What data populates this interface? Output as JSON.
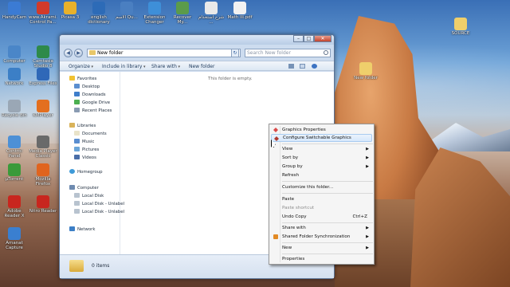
{
  "desktop": {
    "icons": [
      {
        "label": "HandyCam",
        "color": "#3b7bd4"
      },
      {
        "label": "www.Akrami... Control Pa...",
        "color": "#d23a2a"
      },
      {
        "label": "Picasa 3",
        "color": "#e8b12a"
      },
      {
        "label": "english dictionary",
        "color": "#2d6bb7"
      },
      {
        "label": "الاسم Qu...",
        "color": "#4a7fc1"
      },
      {
        "label": "Extension Changer",
        "color": "#3e8fd8"
      },
      {
        "label": "Recover My...",
        "color": "#5b9b4a"
      },
      {
        "label": "شرح استخدام ...",
        "color": "#e9e9e9"
      },
      {
        "label": "Math III.pdf",
        "color": "#f2f2f2"
      },
      {
        "label": "Computer",
        "color": "#4a86c8"
      },
      {
        "label": "Camtasia Studio 8",
        "color": "#2e8a4a"
      },
      {
        "label": "Network",
        "color": "#3c7fc6"
      },
      {
        "label": "Express Files",
        "color": "#2f68b8"
      },
      {
        "label": "Recycle Bin",
        "color": "#9aa7b5"
      },
      {
        "label": "KMPlayer",
        "color": "#e36f1f"
      },
      {
        "label": "Control Panel",
        "color": "#4d90d6"
      },
      {
        "label": "Media Player Classic",
        "color": "#6a6a6a"
      },
      {
        "label": "µTorrent",
        "color": "#3a9a3a"
      },
      {
        "label": "Mozilla Firefox",
        "color": "#e0641e"
      },
      {
        "label": "Adobe Reader X",
        "color": "#c8261e"
      },
      {
        "label": "Nitro Reader",
        "color": "#c8261e"
      },
      {
        "label": "Amanat Capture",
        "color": "#3a7fd0"
      },
      {
        "label": "SOURCE",
        "color": "#efcf6b"
      },
      {
        "label": "New folder",
        "color": "#efcf6b"
      }
    ]
  },
  "window": {
    "address": "New folder",
    "search_placeholder": "Search New folder",
    "toolbar": {
      "organize": "Organize",
      "include_in_library": "Include in library",
      "share_with": "Share with",
      "new_folder": "New folder"
    },
    "nav": {
      "favorites": "Favorites",
      "desktop": "Desktop",
      "downloads": "Downloads",
      "google_drive": "Google Drive",
      "recent_places": "Recent Places",
      "libraries": "Libraries",
      "documents": "Documents",
      "music": "Music",
      "pictures": "Pictures",
      "videos": "Videos",
      "homegroup": "Homegroup",
      "computer": "Computer",
      "local_disk": "Local Disk",
      "local_disk_u1": "Local Disk - Unlabel",
      "local_disk_u2": "Local Disk - Unlabel",
      "network": "Network"
    },
    "empty_message": "This folder is empty.",
    "status": "0 items"
  },
  "context_menu": {
    "graphics_properties": "Graphics Properties",
    "switchable_graphics": "Configure Switchable Graphics",
    "view": "View",
    "sort_by": "Sort by",
    "group_by": "Group by",
    "refresh": "Refresh",
    "customize": "Customize this folder...",
    "paste": "Paste",
    "paste_shortcut": "Paste shortcut",
    "undo_copy": "Undo Copy",
    "undo_copy_accel": "Ctrl+Z",
    "share_with": "Share with",
    "shared_folder_sync": "Shared Folder Synchronization",
    "new": "New",
    "properties": "Properties"
  }
}
